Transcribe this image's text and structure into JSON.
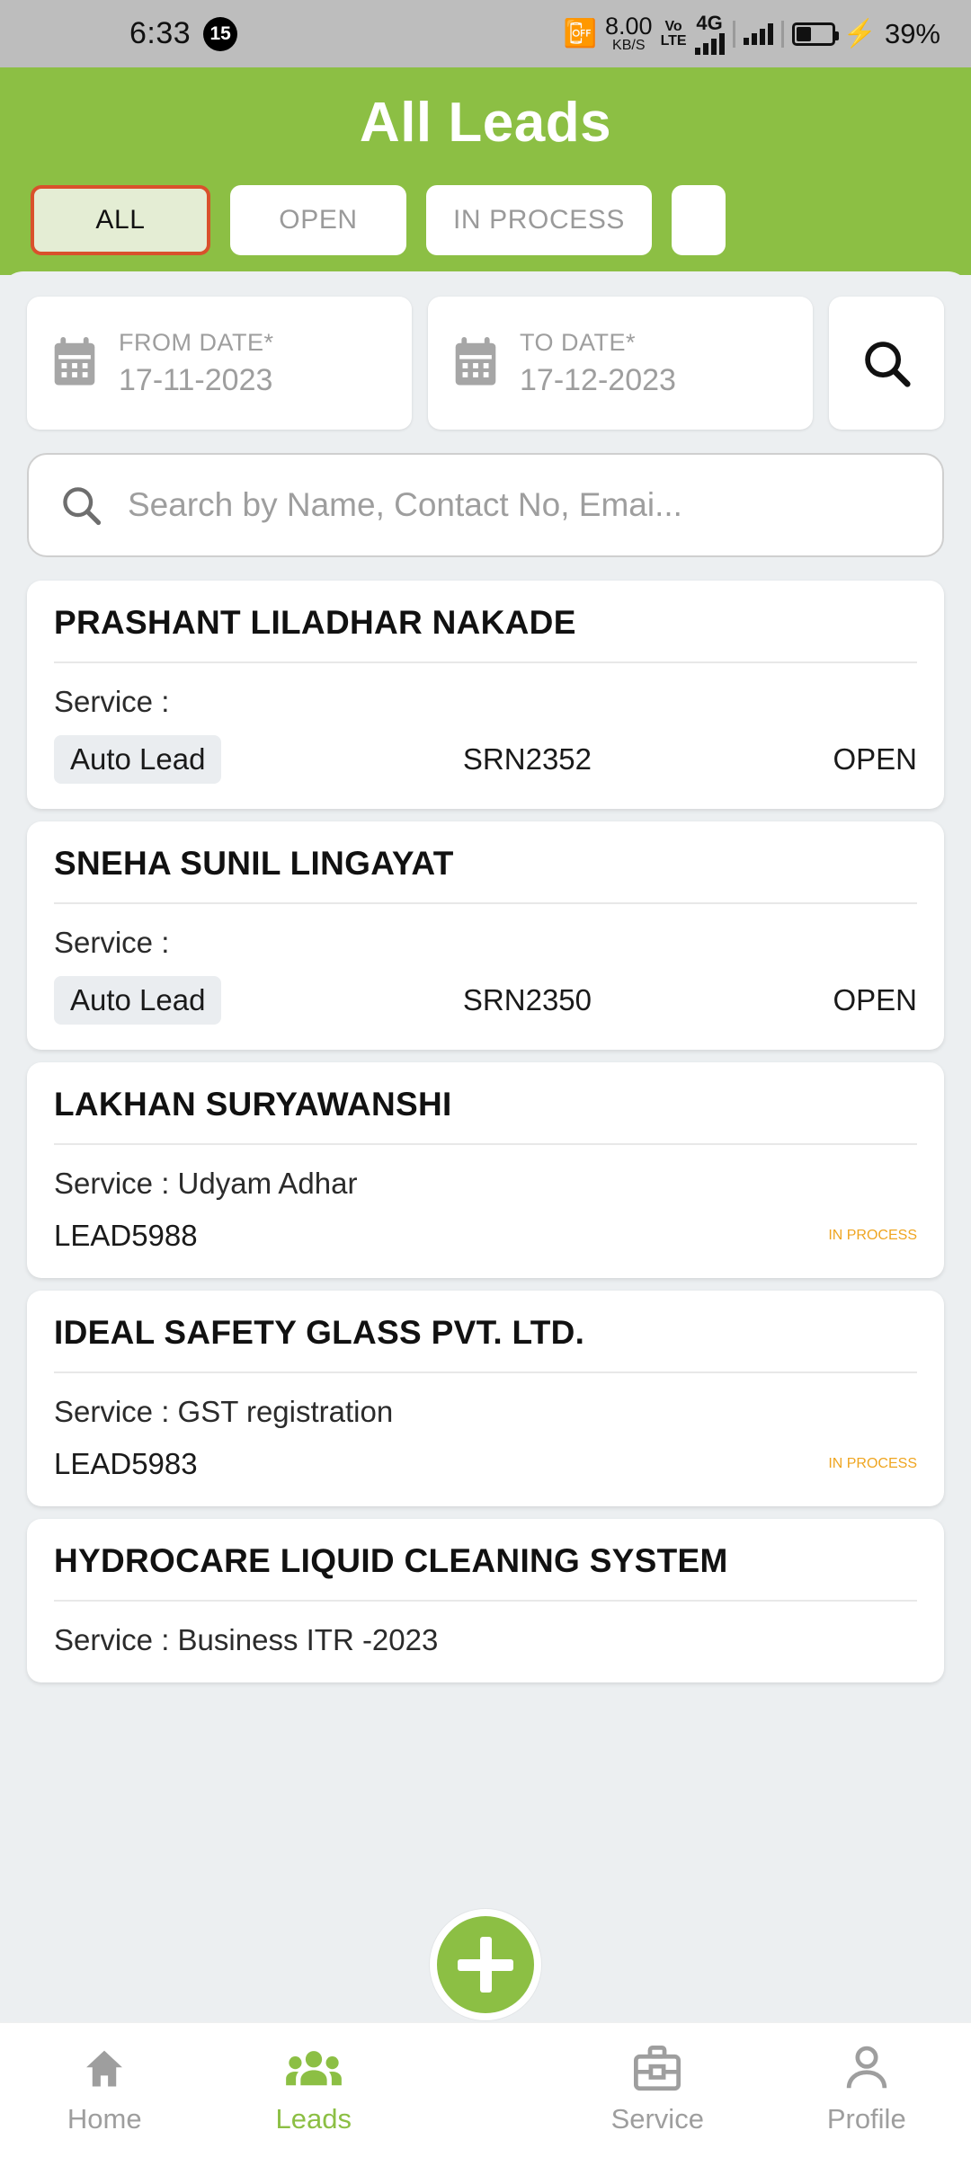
{
  "statusbar": {
    "time": "6:33",
    "notif_badge": "15",
    "net_speed_value": "8.00",
    "net_speed_unit": "KB/S",
    "volte_top": "Vo",
    "volte_bottom": "LTE",
    "network_type": "4G",
    "battery_percent": "39%",
    "vibrate_icon": "vibrate-icon",
    "signal_icon": "signal-bars-icon",
    "battery_icon": "battery-charging-icon"
  },
  "header": {
    "title": "All Leads",
    "tabs": [
      {
        "label": "ALL",
        "active": true
      },
      {
        "label": "OPEN",
        "active": false
      },
      {
        "label": "IN PROCESS",
        "active": false
      },
      {
        "label": "",
        "active": false
      }
    ]
  },
  "filters": {
    "from_date": {
      "label": "FROM DATE*",
      "value": "17-11-2023",
      "icon": "calendar-icon"
    },
    "to_date": {
      "label": "TO DATE*",
      "value": "17-12-2023",
      "icon": "calendar-icon"
    },
    "search_button_icon": "search-icon"
  },
  "search": {
    "placeholder": "Search by Name, Contact No, Emai...",
    "value": "",
    "icon": "search-icon"
  },
  "leads": [
    {
      "name": "PRASHANT LILADHAR NAKADE",
      "service_label": "Service :",
      "service_value": "",
      "chip": "Auto Lead",
      "id": "SRN2352",
      "status": "OPEN",
      "status_type": "open",
      "layout": "chip"
    },
    {
      "name": "SNEHA SUNIL LINGAYAT",
      "service_label": "Service :",
      "service_value": "",
      "chip": "Auto Lead",
      "id": "SRN2350",
      "status": "OPEN",
      "status_type": "open",
      "layout": "chip"
    },
    {
      "name": "LAKHAN SURYAWANSHI",
      "service_label": "Service : Udyam Adhar",
      "service_value": "Udyam Adhar",
      "chip": "",
      "id": "LEAD5988",
      "status": "IN PROCESS",
      "status_type": "process",
      "layout": "plain"
    },
    {
      "name": "IDEAL SAFETY GLASS PVT. LTD.",
      "service_label": "Service : GST registration",
      "service_value": "GST registration",
      "chip": "",
      "id": "LEAD5983",
      "status": "IN PROCESS",
      "status_type": "process",
      "layout": "plain"
    },
    {
      "name": "HYDROCARE LIQUID CLEANING SYSTEM",
      "service_label": "Service : Business  ITR        -2023",
      "service_value": "Business  ITR        -2023",
      "chip": "",
      "id": "",
      "status": "",
      "status_type": "",
      "layout": "plain"
    }
  ],
  "fab": {
    "label": "add-lead",
    "icon": "plus-icon"
  },
  "bottomnav": [
    {
      "label": "Home",
      "icon": "home-icon",
      "active": false
    },
    {
      "label": "Leads",
      "icon": "people-icon",
      "active": true
    },
    {
      "label": "Service",
      "icon": "toolbox-icon",
      "active": false
    },
    {
      "label": "Profile",
      "icon": "person-icon",
      "active": false
    }
  ],
  "colors": {
    "brand_green": "#8CBF44",
    "selected_tab_border": "#D9512C",
    "selected_tab_fill": "#E4EDD4",
    "status_in_process": "#EFA520",
    "page_background": "#ECEFF1"
  }
}
